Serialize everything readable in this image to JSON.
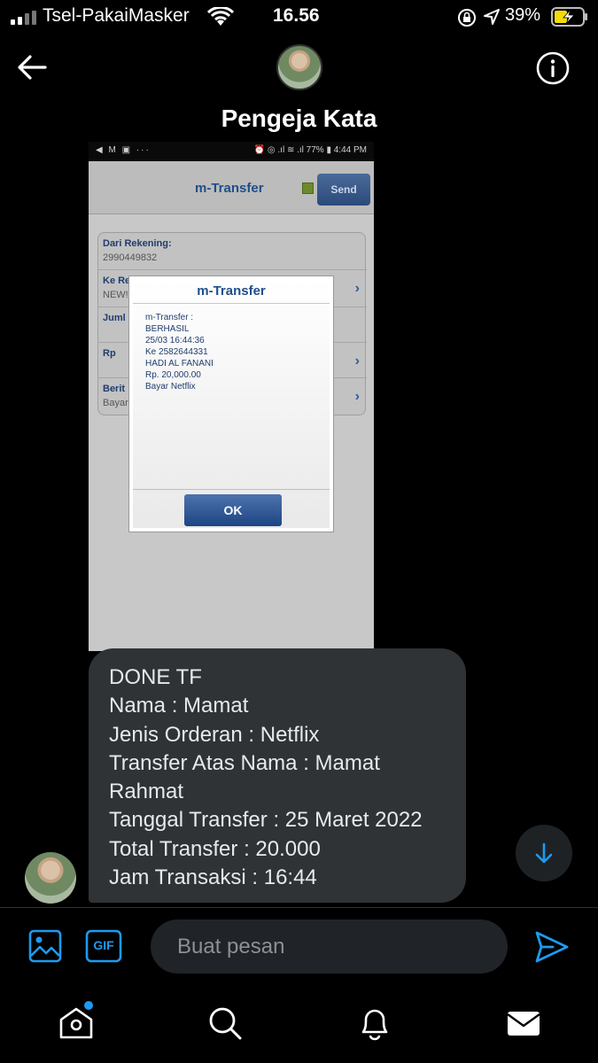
{
  "status_bar": {
    "carrier": "Tsel-PakaiMasker",
    "time": "16.56",
    "battery_percent": "39%"
  },
  "header": {
    "conversation_name": "Pengeja Kata"
  },
  "screenshot": {
    "status_left": "◀ M ▣ ···",
    "status_right": "⏰ ◎ .ıl ≋ .ıl 77% ▮ 4:44 PM",
    "app_title": "m-Transfer",
    "send_label": "Send",
    "form": [
      {
        "label": "Dari Rekening:",
        "value": "2990449832"
      },
      {
        "label": "Ke Re",
        "value": "NEW!"
      },
      {
        "label": "Juml",
        "value": ""
      },
      {
        "label": "Rp",
        "value": ""
      },
      {
        "label": "Berit",
        "value": "Bayar"
      }
    ],
    "dialog": {
      "title": "m-Transfer",
      "lines": [
        "m-Transfer :",
        "BERHASIL",
        "25/03 16:44:36",
        "Ke 2582644331",
        "HADI AL FANANI",
        "Rp. 20,000.00",
        "Bayar Netflix"
      ],
      "ok_label": "OK"
    }
  },
  "message": {
    "lines": [
      "DONE TF",
      "Nama : Mamat",
      "Jenis Orderan : Netflix",
      "Transfer Atas Nama : Mamat",
      "Rahmat",
      "Tanggal Transfer : 25 Maret 2022",
      "Total Transfer : 20.000",
      "Jam Transaksi : 16:44"
    ]
  },
  "composer": {
    "placeholder": "Buat pesan",
    "gif_label": "GIF"
  },
  "colors": {
    "accent": "#1d9bf0",
    "bubble": "#2f3336",
    "background": "#000000"
  },
  "icons": [
    "back-arrow-icon",
    "info-icon",
    "image-icon",
    "gif-icon",
    "send-icon",
    "home-icon",
    "search-icon",
    "bell-icon",
    "mail-icon",
    "arrow-down-icon"
  ]
}
